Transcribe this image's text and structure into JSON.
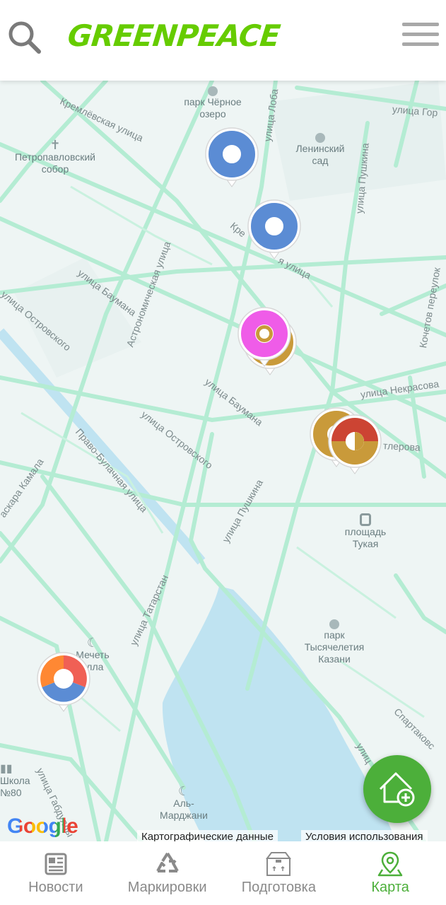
{
  "header": {
    "logo_text": "GREENPEACE",
    "search_icon": "search-icon",
    "menu_icon": "hamburger-menu-icon"
  },
  "map": {
    "street_labels": {
      "kremlevskaya": "Кремлёвская улица",
      "gorkogo": "улица Гор",
      "loba": "улица Лоба",
      "pushkina_top": "улица Пушкина",
      "pushkina_mid": "улица Пушкина",
      "astronomicheskaya": "Астрономическая улица",
      "kremlevskaya_2": "Кре",
      "kremlevskaya_2b": "я улица",
      "baumana_1": "улица Баумана",
      "baumana_2": "улица Баумана",
      "ostrovskogo_1": "улица Островского",
      "ostrovskogo_2": "улица Островского",
      "nekrasova": "улица Некрасова",
      "butlerova": "тлерова",
      "pravo_bulachnaya": "Право-Булачная улица",
      "karla_kamala": "аскара Камала",
      "tatarstan": "улица Татарстан",
      "gabdully": "улица Габдуллы",
      "spartakovskaya": "Спартаковс",
      "kochetova": "Кочетов переулок",
      "ulitsa_edge": "улиц"
    },
    "pois": {
      "park_chernoe_ozero": "парк Чёрное озеро",
      "petropavlovsky": "Петропавловский собор",
      "leninsky_sad": "Ленинский сад",
      "ploshad_tukaya": "площадь Тукая",
      "park_tysyacheletiya": "парк Тысячелетия Казани",
      "mosque": "Мечеть",
      "mosque_2": "улла",
      "school": "Школа №80",
      "al_mardzhani": "Аль-Марджани"
    },
    "google_logo": "Google",
    "attribution_data": "Картографические данные",
    "attribution_terms": "Условия использования",
    "pin_colors": {
      "blue": "#5b8cd4",
      "magenta": "#ef5ce8",
      "gold": "#c99a3a",
      "red": "#cc4433",
      "orange": "#ff8833",
      "coral": "#f06055"
    }
  },
  "fab": {
    "icon": "add-home-icon"
  },
  "bottom_nav": [
    {
      "label": "Новости",
      "icon": "news-icon",
      "active": false
    },
    {
      "label": "Маркировки",
      "icon": "recycle-icon",
      "active": false
    },
    {
      "label": "Подготовка",
      "icon": "box-icon",
      "active": false
    },
    {
      "label": "Карта",
      "icon": "map-pin-icon",
      "active": true
    }
  ]
}
